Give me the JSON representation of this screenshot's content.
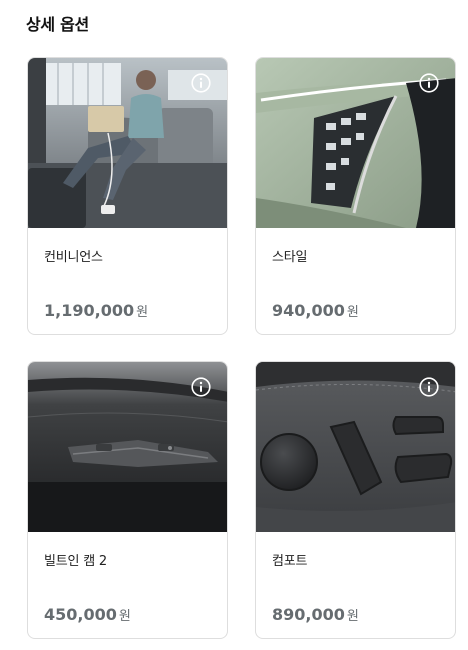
{
  "section": {
    "title": "상세 옵션"
  },
  "options": [
    {
      "name": "컨비니언스",
      "price": "1,190,000",
      "unit": "원",
      "image": "rear-seat-passenger-laptop",
      "info_icon": "info-icon"
    },
    {
      "name": "스타일",
      "price": "940,000",
      "unit": "원",
      "image": "led-headlamp-closeup",
      "info_icon": "info-icon"
    },
    {
      "name": "빌트인 캠 2",
      "price": "450,000",
      "unit": "원",
      "image": "headliner-builtin-camera",
      "info_icon": "info-icon"
    },
    {
      "name": "컴포트",
      "price": "890,000",
      "unit": "원",
      "image": "power-seat-controls",
      "info_icon": "info-icon"
    }
  ],
  "colors": {
    "title": "#111111",
    "price": "#666c70",
    "card_border": "#dedede"
  }
}
